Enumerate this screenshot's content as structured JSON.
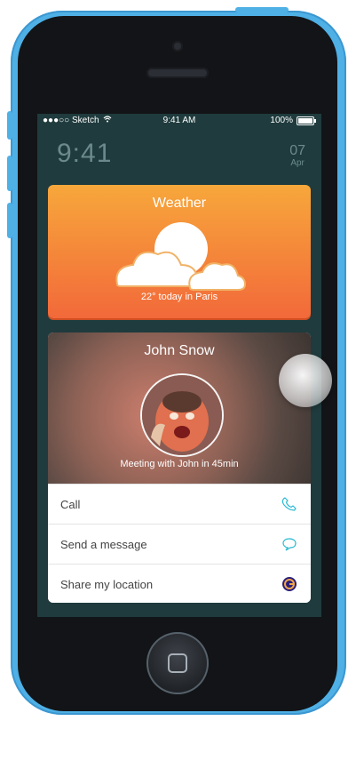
{
  "status_bar": {
    "carrier": "●●●○○ Sketch",
    "time": "9:41 AM",
    "battery": "100%"
  },
  "lock_screen": {
    "time": "9:41",
    "day": "07",
    "month": "Apr"
  },
  "weather_card": {
    "title": "Weather",
    "subtitle": "22° today in Paris",
    "icon": "cloud-sun-icon"
  },
  "contact_card": {
    "name": "John Snow",
    "meeting_text": "Meeting with John in 45min",
    "actions": [
      {
        "label": "Call",
        "icon": "phone-icon",
        "color": "#2bbad1"
      },
      {
        "label": "Send a message",
        "icon": "message-bubble-icon",
        "color": "#2bbad1"
      },
      {
        "label": "Share my location",
        "icon": "location-app-icon",
        "color": "#2a1f7a"
      }
    ]
  },
  "colors": {
    "screen_bg": "#1f3b3d",
    "weather_gradient_top": "#f7a73b",
    "weather_gradient_bottom": "#f2693a",
    "phone_body": "#4fb0e6"
  }
}
